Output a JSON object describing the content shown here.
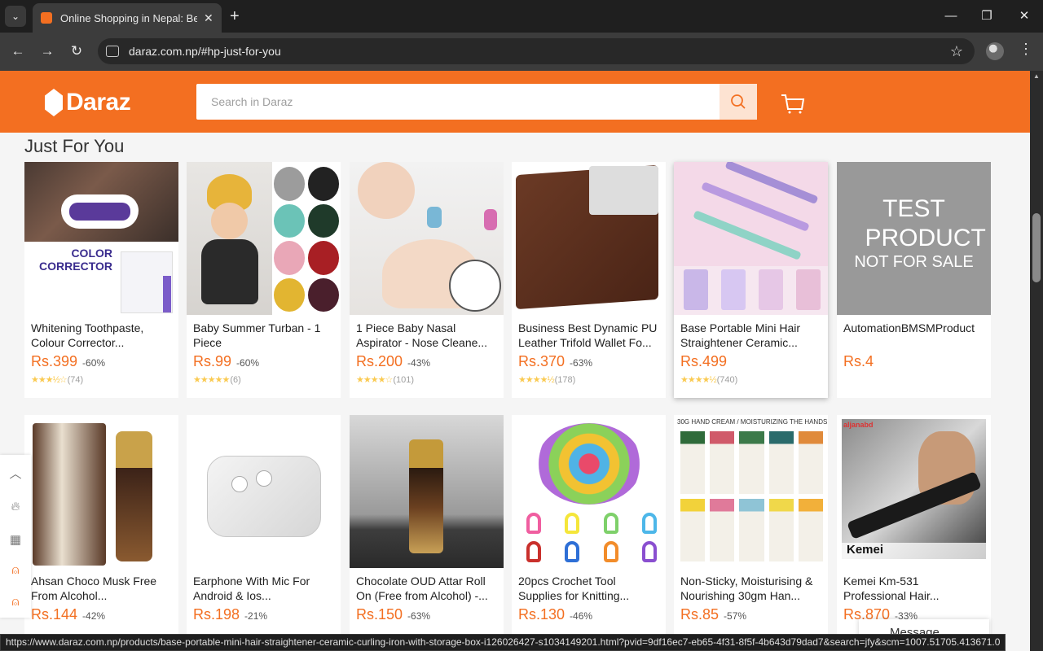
{
  "browser": {
    "tab_title": "Online Shopping in Nepal: Best",
    "url": "daraz.com.np/#hp-just-for-you",
    "status_url": "https://www.daraz.com.np/products/base-portable-mini-hair-straightener-ceramic-curling-iron-with-storage-box-i126026427-s1034149201.html?pvid=9df16ec7-eb65-4f31-8f5f-4b643d79dad7&search=jfy&scm=1007.51705.413671.0"
  },
  "header": {
    "logo_text": "Daraz",
    "search_placeholder": "Search in Daraz",
    "brand_color": "#f36f21"
  },
  "section": {
    "title": "Just For You"
  },
  "products_row1": [
    {
      "name": "Whitening Toothpaste, Colour Corrector...",
      "price": "Rs.399",
      "discount": "-60%",
      "stars": "★★★½☆",
      "reviews": "(74)",
      "image_text": "COLOR CORRECTOR"
    },
    {
      "name": "Baby Summer Turban - 1 Piece",
      "price": "Rs.99",
      "discount": "-60%",
      "stars": "★★★★★",
      "reviews": "(6)"
    },
    {
      "name": "1 Piece Baby Nasal Aspirator - Nose Cleane...",
      "price": "Rs.200",
      "discount": "-43%",
      "stars": "★★★★☆",
      "reviews": "(101)"
    },
    {
      "name": "Business Best Dynamic PU Leather Trifold Wallet Fo...",
      "price": "Rs.370",
      "discount": "-63%",
      "stars": "★★★★½",
      "reviews": "(178)"
    },
    {
      "name": "Base Portable Mini Hair Straightener Ceramic...",
      "price": "Rs.499",
      "discount": "",
      "stars": "★★★★½",
      "reviews": "(740)"
    },
    {
      "name": "AutomationBMSMProduct",
      "price": "Rs.4",
      "discount": "",
      "stars": "",
      "reviews": "",
      "image_text": "TEST PRODUCT",
      "image_subtext": "NOT FOR SALE"
    }
  ],
  "products_row2": [
    {
      "name": "Ahsan Choco Musk Free From Alcohol...",
      "price": "Rs.144",
      "discount": "-42%"
    },
    {
      "name": "Earphone With Mic For Android & Ios...",
      "price": "Rs.198",
      "discount": "-21%"
    },
    {
      "name": "Chocolate OUD Attar Roll On (Free from Alcohol) -...",
      "price": "Rs.150",
      "discount": "-63%"
    },
    {
      "name": "20pcs Crochet Tool Supplies for Knitting...",
      "price": "Rs.130",
      "discount": "-46%"
    },
    {
      "name": "Non-Sticky, Moisturising & Nourishing 30gm Han...",
      "price": "Rs.85",
      "discount": "-57%",
      "image_text": "30G HAND CREAM / MOISTURIZING THE HANDS"
    },
    {
      "name": "Kemei Km-531 Professional Hair...",
      "price": "Rs.870",
      "discount": "-33%",
      "image_text": "Kemei",
      "image_brand": "aljanabd"
    }
  ],
  "message_popup": "Message"
}
